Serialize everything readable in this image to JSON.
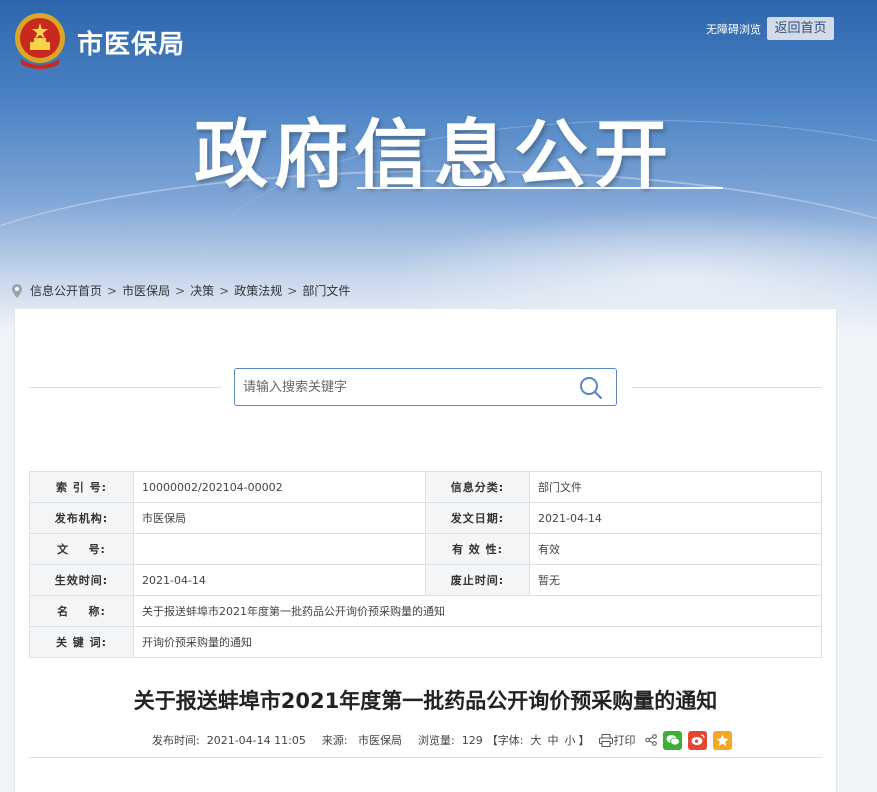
{
  "header": {
    "site_name": "市医保局",
    "accessible_label": "无障碍浏览",
    "home_label": "返回首页",
    "hero_title": "政府信息公开"
  },
  "breadcrumb": {
    "items": [
      "信息公开首页",
      "市医保局",
      "决策",
      "政策法规",
      "部门文件"
    ],
    "separator": ">"
  },
  "search": {
    "placeholder": "请输入搜索关键字"
  },
  "info": {
    "index_label": "索 引 号:",
    "index_value": "10000002/202104-00002",
    "category_label": "信息分类:",
    "category_value": "部门文件",
    "publisher_label": "发布机构:",
    "publisher_value": "市医保局",
    "issue_date_label": "发文日期:",
    "issue_date_value": "2021-04-14",
    "doc_no_label": "文    号:",
    "doc_no_value": "",
    "validity_label": "有 效 性:",
    "validity_value": "有效",
    "effective_label": "生效时间:",
    "effective_value": "2021-04-14",
    "repeal_label": "废止时间:",
    "repeal_value": "暂无",
    "name_label": "名    称:",
    "name_value": "关于报送蚌埠市2021年度第一批药品公开询价预采购量的通知",
    "keywords_label": "关 键 词:",
    "keywords_value": "开询价预采购量的通知"
  },
  "article": {
    "title": "关于报送蚌埠市2021年度第一批药品公开询价预采购量的通知",
    "publish_time": "发布时间:  2021-04-14 11:05",
    "source": "来源:   市医保局",
    "views": "浏览量:  129",
    "font_open": "【字体:",
    "font_large": "大",
    "font_medium": "中",
    "font_small": "小",
    "font_close": "】",
    "print_label": "打印"
  },
  "colors": {
    "banner_top": "#2e66ad",
    "search_border": "#5b86bd",
    "wechat": "#3cb034",
    "weibo": "#e6452f",
    "favorite": "#f6a623"
  }
}
